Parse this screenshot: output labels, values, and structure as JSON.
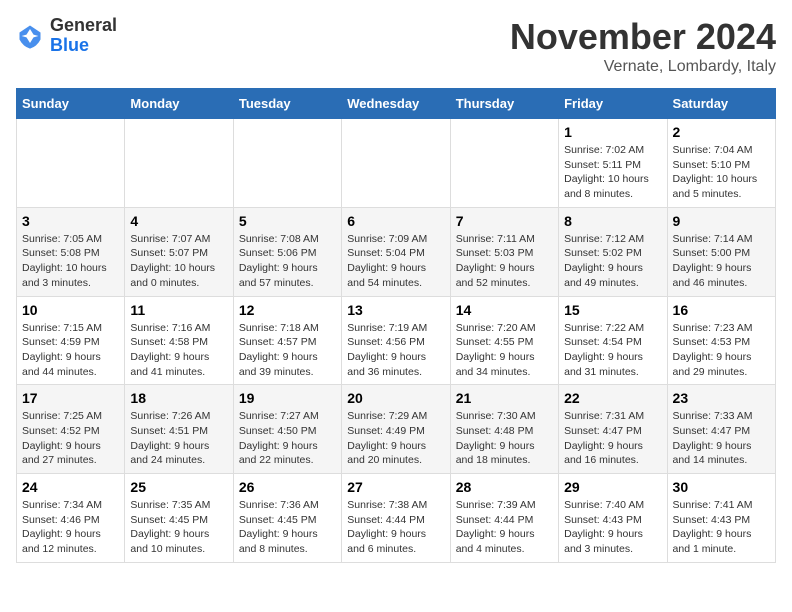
{
  "header": {
    "logo_general": "General",
    "logo_blue": "Blue",
    "month_title": "November 2024",
    "location": "Vernate, Lombardy, Italy"
  },
  "days_of_week": [
    "Sunday",
    "Monday",
    "Tuesday",
    "Wednesday",
    "Thursday",
    "Friday",
    "Saturday"
  ],
  "weeks": [
    [
      {
        "day": "",
        "detail": ""
      },
      {
        "day": "",
        "detail": ""
      },
      {
        "day": "",
        "detail": ""
      },
      {
        "day": "",
        "detail": ""
      },
      {
        "day": "",
        "detail": ""
      },
      {
        "day": "1",
        "detail": "Sunrise: 7:02 AM\nSunset: 5:11 PM\nDaylight: 10 hours and 8 minutes."
      },
      {
        "day": "2",
        "detail": "Sunrise: 7:04 AM\nSunset: 5:10 PM\nDaylight: 10 hours and 5 minutes."
      }
    ],
    [
      {
        "day": "3",
        "detail": "Sunrise: 7:05 AM\nSunset: 5:08 PM\nDaylight: 10 hours and 3 minutes."
      },
      {
        "day": "4",
        "detail": "Sunrise: 7:07 AM\nSunset: 5:07 PM\nDaylight: 10 hours and 0 minutes."
      },
      {
        "day": "5",
        "detail": "Sunrise: 7:08 AM\nSunset: 5:06 PM\nDaylight: 9 hours and 57 minutes."
      },
      {
        "day": "6",
        "detail": "Sunrise: 7:09 AM\nSunset: 5:04 PM\nDaylight: 9 hours and 54 minutes."
      },
      {
        "day": "7",
        "detail": "Sunrise: 7:11 AM\nSunset: 5:03 PM\nDaylight: 9 hours and 52 minutes."
      },
      {
        "day": "8",
        "detail": "Sunrise: 7:12 AM\nSunset: 5:02 PM\nDaylight: 9 hours and 49 minutes."
      },
      {
        "day": "9",
        "detail": "Sunrise: 7:14 AM\nSunset: 5:00 PM\nDaylight: 9 hours and 46 minutes."
      }
    ],
    [
      {
        "day": "10",
        "detail": "Sunrise: 7:15 AM\nSunset: 4:59 PM\nDaylight: 9 hours and 44 minutes."
      },
      {
        "day": "11",
        "detail": "Sunrise: 7:16 AM\nSunset: 4:58 PM\nDaylight: 9 hours and 41 minutes."
      },
      {
        "day": "12",
        "detail": "Sunrise: 7:18 AM\nSunset: 4:57 PM\nDaylight: 9 hours and 39 minutes."
      },
      {
        "day": "13",
        "detail": "Sunrise: 7:19 AM\nSunset: 4:56 PM\nDaylight: 9 hours and 36 minutes."
      },
      {
        "day": "14",
        "detail": "Sunrise: 7:20 AM\nSunset: 4:55 PM\nDaylight: 9 hours and 34 minutes."
      },
      {
        "day": "15",
        "detail": "Sunrise: 7:22 AM\nSunset: 4:54 PM\nDaylight: 9 hours and 31 minutes."
      },
      {
        "day": "16",
        "detail": "Sunrise: 7:23 AM\nSunset: 4:53 PM\nDaylight: 9 hours and 29 minutes."
      }
    ],
    [
      {
        "day": "17",
        "detail": "Sunrise: 7:25 AM\nSunset: 4:52 PM\nDaylight: 9 hours and 27 minutes."
      },
      {
        "day": "18",
        "detail": "Sunrise: 7:26 AM\nSunset: 4:51 PM\nDaylight: 9 hours and 24 minutes."
      },
      {
        "day": "19",
        "detail": "Sunrise: 7:27 AM\nSunset: 4:50 PM\nDaylight: 9 hours and 22 minutes."
      },
      {
        "day": "20",
        "detail": "Sunrise: 7:29 AM\nSunset: 4:49 PM\nDaylight: 9 hours and 20 minutes."
      },
      {
        "day": "21",
        "detail": "Sunrise: 7:30 AM\nSunset: 4:48 PM\nDaylight: 9 hours and 18 minutes."
      },
      {
        "day": "22",
        "detail": "Sunrise: 7:31 AM\nSunset: 4:47 PM\nDaylight: 9 hours and 16 minutes."
      },
      {
        "day": "23",
        "detail": "Sunrise: 7:33 AM\nSunset: 4:47 PM\nDaylight: 9 hours and 14 minutes."
      }
    ],
    [
      {
        "day": "24",
        "detail": "Sunrise: 7:34 AM\nSunset: 4:46 PM\nDaylight: 9 hours and 12 minutes."
      },
      {
        "day": "25",
        "detail": "Sunrise: 7:35 AM\nSunset: 4:45 PM\nDaylight: 9 hours and 10 minutes."
      },
      {
        "day": "26",
        "detail": "Sunrise: 7:36 AM\nSunset: 4:45 PM\nDaylight: 9 hours and 8 minutes."
      },
      {
        "day": "27",
        "detail": "Sunrise: 7:38 AM\nSunset: 4:44 PM\nDaylight: 9 hours and 6 minutes."
      },
      {
        "day": "28",
        "detail": "Sunrise: 7:39 AM\nSunset: 4:44 PM\nDaylight: 9 hours and 4 minutes."
      },
      {
        "day": "29",
        "detail": "Sunrise: 7:40 AM\nSunset: 4:43 PM\nDaylight: 9 hours and 3 minutes."
      },
      {
        "day": "30",
        "detail": "Sunrise: 7:41 AM\nSunset: 4:43 PM\nDaylight: 9 hours and 1 minute."
      }
    ]
  ]
}
